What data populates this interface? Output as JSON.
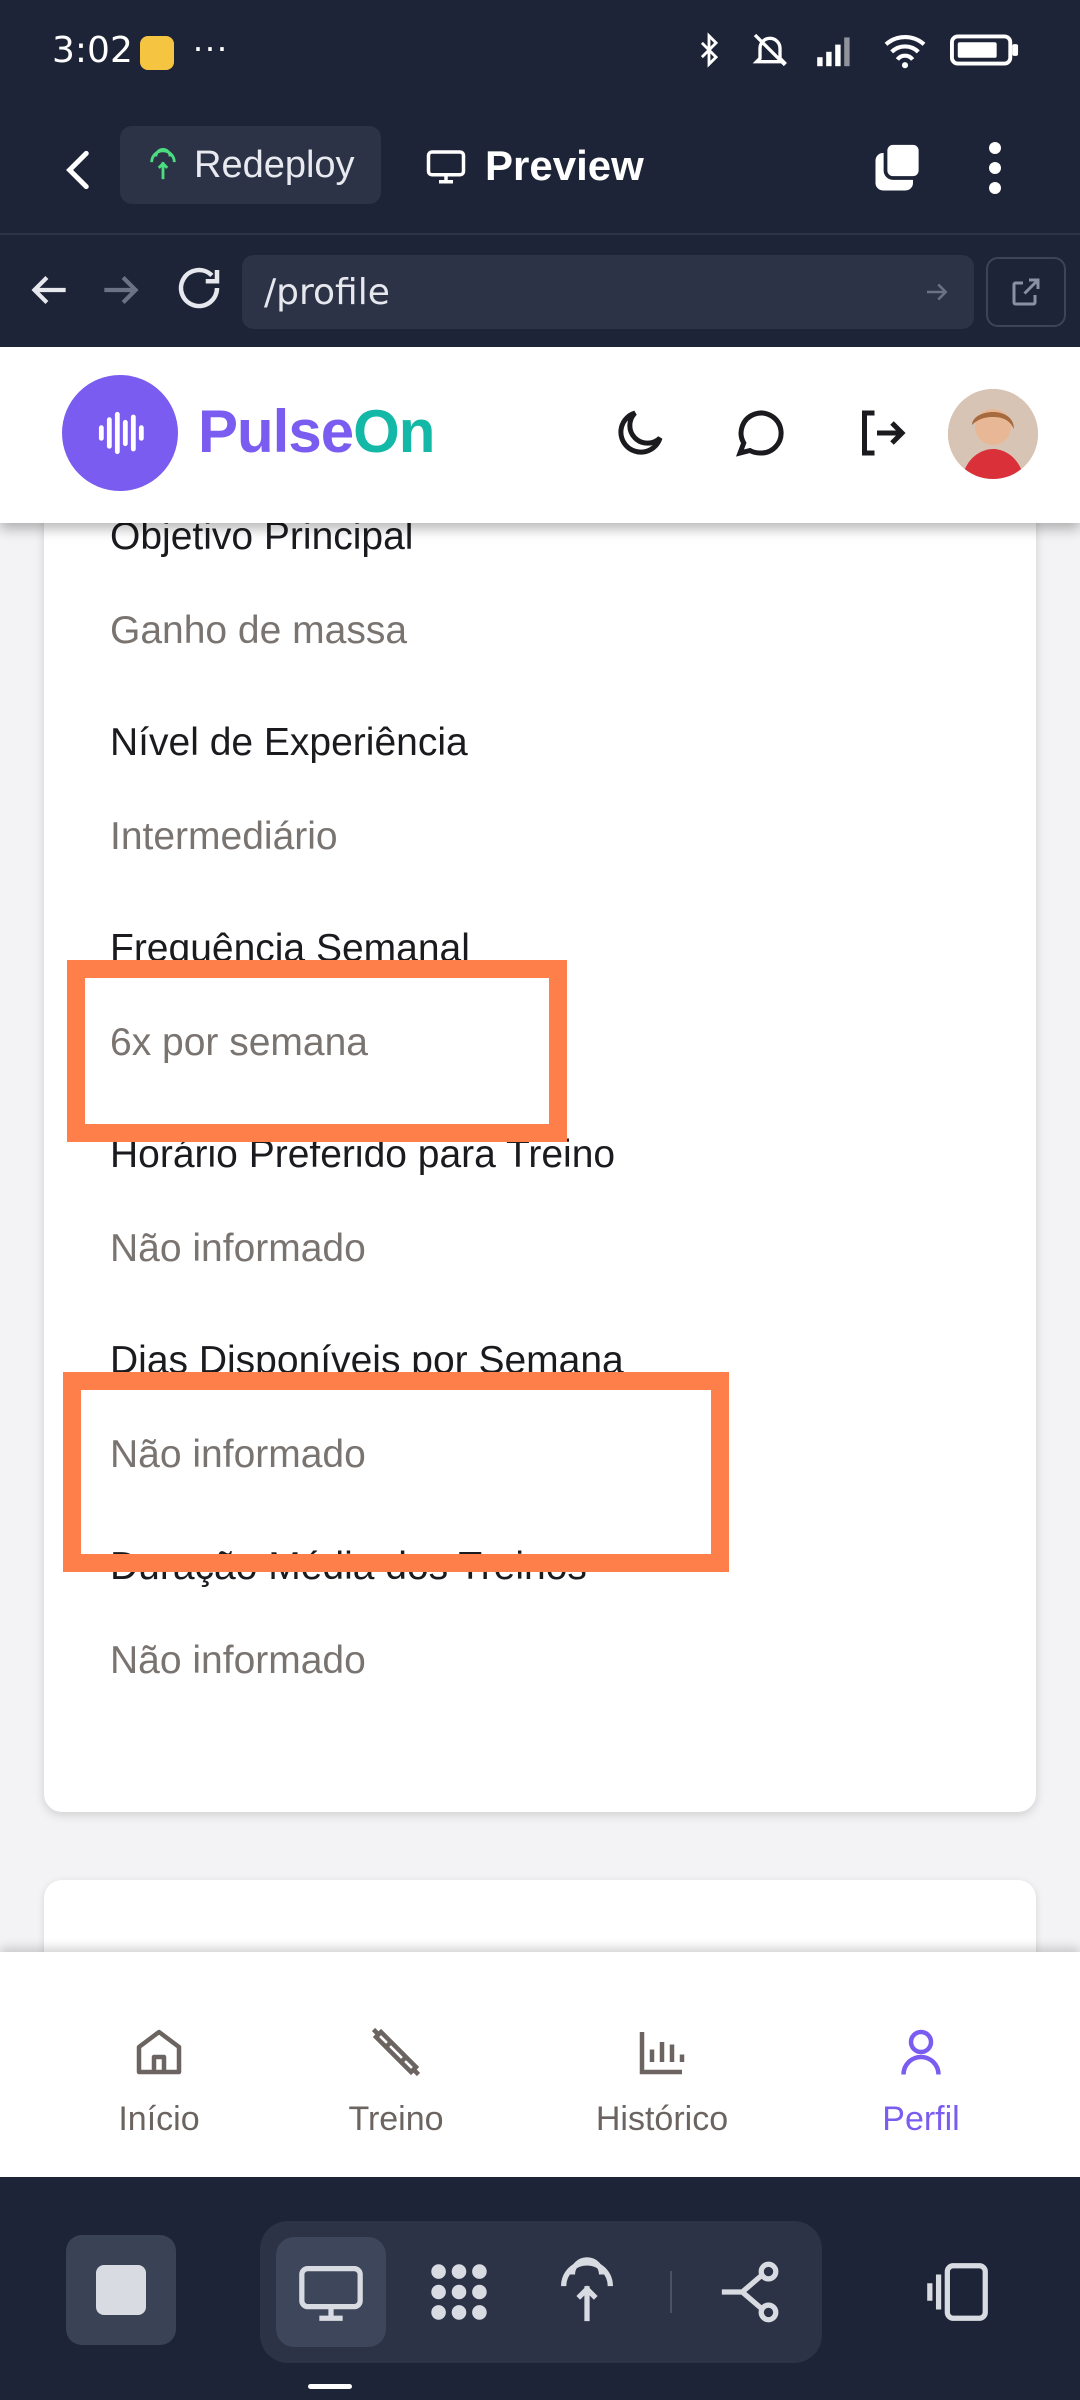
{
  "status_bar": {
    "time": "3:02",
    "overflow": "···"
  },
  "header": {
    "redeploy_label": "Redeploy",
    "preview_label": "Preview"
  },
  "urlbar": {
    "url": "/profile"
  },
  "app": {
    "brand_part1": "Pulse",
    "brand_part2": "On",
    "brand_colors": {
      "primary": "#7b5cf0",
      "accent": "#14b8a6"
    }
  },
  "profile_fields": [
    {
      "label": "Objetivo Principal",
      "value": "Ganho de massa"
    },
    {
      "label": "Nível de Experiência",
      "value": "Intermediário"
    },
    {
      "label": "Frequência Semanal",
      "value": "6x por semana"
    },
    {
      "label": "Horário Preferido para Treino",
      "value": "Não informado"
    },
    {
      "label": "Dias Disponíveis por Semana",
      "value": "Não informado"
    },
    {
      "label": "Duração Média dos Treinos",
      "value": "Não informado"
    }
  ],
  "highlight_color": "#ff7f4a",
  "bottom_nav": [
    {
      "label": "Início",
      "icon": "home-icon"
    },
    {
      "label": "Treino",
      "icon": "dumbbell-icon"
    },
    {
      "label": "Histórico",
      "icon": "bar-chart-icon"
    },
    {
      "label": "Perfil",
      "icon": "user-icon",
      "active": true
    }
  ]
}
